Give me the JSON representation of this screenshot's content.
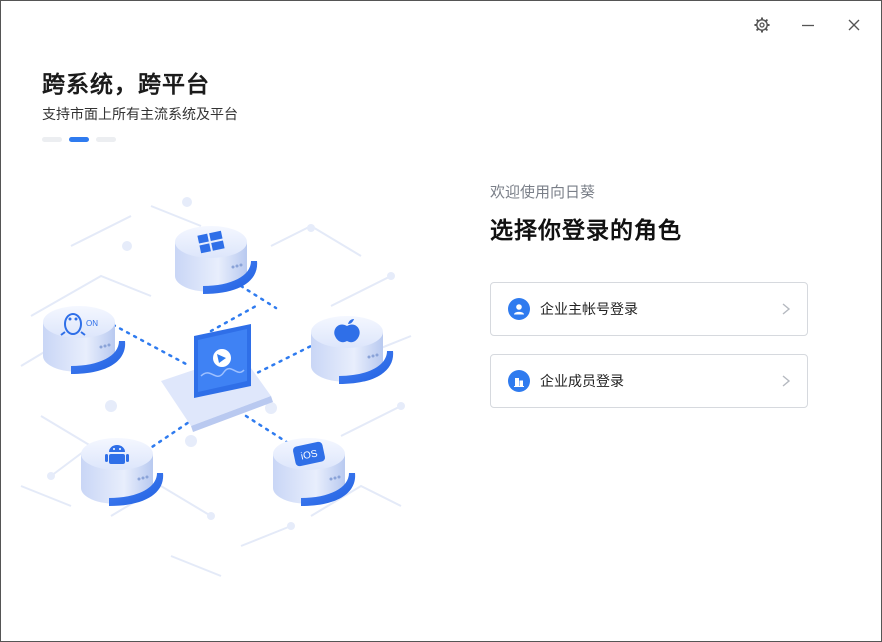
{
  "titlebar": {
    "settings_icon": "gear-icon",
    "minimize_icon": "minimize-icon",
    "close_icon": "close-icon"
  },
  "hero": {
    "title": "跨系统，跨平台",
    "subtitle": "支持市面上所有主流系统及平台",
    "carousel": {
      "count": 3,
      "active_index": 1
    }
  },
  "login": {
    "welcome": "欢迎使用向日葵",
    "title": "选择你登录的角色",
    "options": [
      {
        "label": "企业主帐号登录",
        "icon": "user-icon"
      },
      {
        "label": "企业成员登录",
        "icon": "building-icon"
      }
    ]
  },
  "illustration": {
    "platforms": [
      "windows-icon",
      "macos-icon",
      "linux-icon",
      "android-icon",
      "ios-icon"
    ],
    "ios_label": "iOS"
  },
  "colors": {
    "accent": "#2f7bef",
    "border": "#d6d9de",
    "muted": "#7a7f88"
  }
}
